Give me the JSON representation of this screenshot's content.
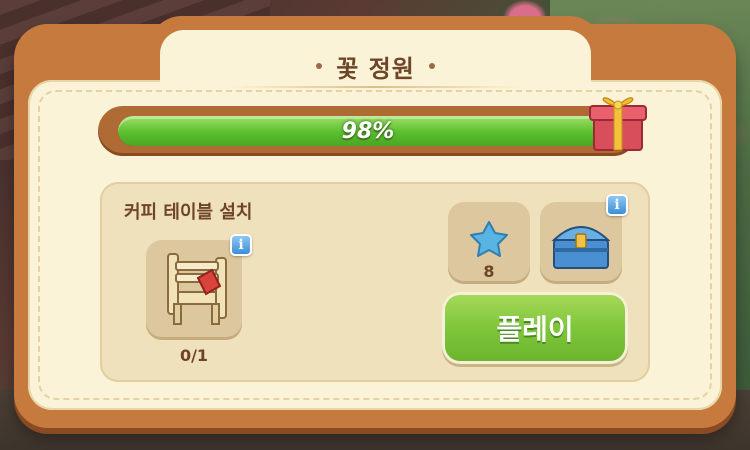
{
  "panel": {
    "title": "꽃 정원"
  },
  "progress": {
    "value": 0.98,
    "label": "98%"
  },
  "task": {
    "title": "커피 테이블 설치",
    "item_count": "0/1"
  },
  "rewards": {
    "stars": "8"
  },
  "info_icon": "i",
  "play_button": "플레이",
  "colors": {
    "panel_border": "#c77a3e",
    "panel_fill": "#fbf3d7",
    "progress_fill": "#5bbf2e",
    "play_button": "#7ec63a",
    "title_text": "#6f4527"
  }
}
